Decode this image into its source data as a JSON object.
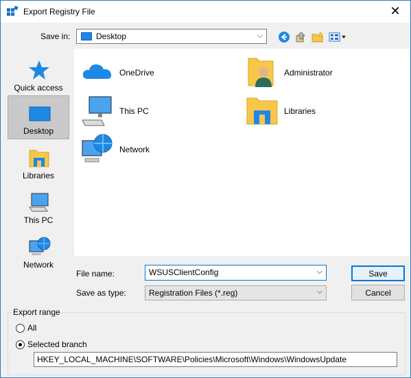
{
  "window": {
    "title": "Export Registry File",
    "close": "✕"
  },
  "toolbar": {
    "save_in_label": "Save in:",
    "save_in_value": "Desktop"
  },
  "places": [
    {
      "label": "Quick access",
      "icon": "star-icon",
      "selected": false
    },
    {
      "label": "Desktop",
      "icon": "desktop-icon",
      "selected": true
    },
    {
      "label": "Libraries",
      "icon": "libraries-icon",
      "selected": false
    },
    {
      "label": "This PC",
      "icon": "computer-icon",
      "selected": false
    },
    {
      "label": "Network",
      "icon": "network-icon",
      "selected": false
    }
  ],
  "files": [
    {
      "label": "OneDrive",
      "icon": "onedrive-icon"
    },
    {
      "label": "Administrator",
      "icon": "user-folder-icon"
    },
    {
      "label": "This PC",
      "icon": "computer-icon"
    },
    {
      "label": "Libraries",
      "icon": "libraries-icon"
    },
    {
      "label": "Network",
      "icon": "network-icon"
    }
  ],
  "form": {
    "file_name_label": "File name:",
    "file_name_value": "WSUSClientConfig",
    "save_as_type_label": "Save as type:",
    "save_as_type_value": "Registration Files (*.reg)",
    "dropdown_glyph": "⌵"
  },
  "buttons": {
    "save": "Save",
    "cancel": "Cancel"
  },
  "export_range": {
    "legend": "Export range",
    "all_label": "All",
    "selected_label": "Selected branch",
    "selected_checked": true,
    "branch_value": "HKEY_LOCAL_MACHINE\\SOFTWARE\\Policies\\Microsoft\\Windows\\WindowsUpdate"
  },
  "colors": {
    "accent": "#0078d7",
    "folder_yellow": "#f8c74a",
    "selection": "#c9c9c9"
  }
}
